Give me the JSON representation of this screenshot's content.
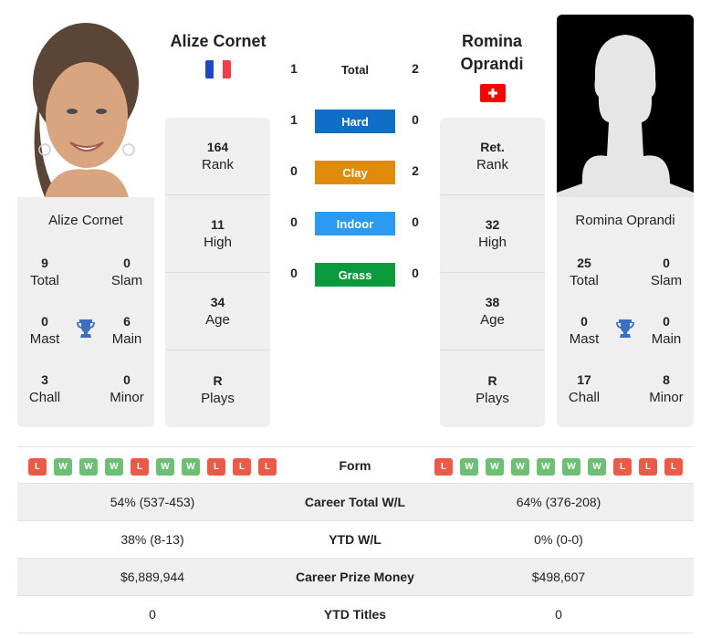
{
  "player_left": {
    "name": "Alize Cornet",
    "card_name": "Alize Cornet",
    "flag": "france-flag",
    "rank": {
      "value": "164",
      "label": "Rank"
    },
    "high": {
      "value": "11",
      "label": "High"
    },
    "age": {
      "value": "34",
      "label": "Age"
    },
    "plays": {
      "value": "R",
      "label": "Plays"
    },
    "titles": {
      "total": {
        "value": "9",
        "label": "Total"
      },
      "slam": {
        "value": "0",
        "label": "Slam"
      },
      "mast": {
        "value": "0",
        "label": "Mast"
      },
      "main": {
        "value": "6",
        "label": "Main"
      },
      "chall": {
        "value": "3",
        "label": "Chall"
      },
      "minor": {
        "value": "0",
        "label": "Minor"
      }
    },
    "form": [
      "L",
      "W",
      "W",
      "W",
      "L",
      "W",
      "W",
      "L",
      "L",
      "L"
    ]
  },
  "player_right": {
    "name_line1": "Romina",
    "name_line2": "Oprandi",
    "card_name": "Romina Oprandi",
    "flag": "switzerland-flag",
    "rank": {
      "value": "Ret.",
      "label": "Rank"
    },
    "high": {
      "value": "32",
      "label": "High"
    },
    "age": {
      "value": "38",
      "label": "Age"
    },
    "plays": {
      "value": "R",
      "label": "Plays"
    },
    "titles": {
      "total": {
        "value": "25",
        "label": "Total"
      },
      "slam": {
        "value": "0",
        "label": "Slam"
      },
      "mast": {
        "value": "0",
        "label": "Mast"
      },
      "main": {
        "value": "0",
        "label": "Main"
      },
      "chall": {
        "value": "17",
        "label": "Chall"
      },
      "minor": {
        "value": "8",
        "label": "Minor"
      }
    },
    "form": [
      "L",
      "W",
      "W",
      "W",
      "W",
      "W",
      "W",
      "L",
      "L",
      "L"
    ]
  },
  "h2h": {
    "total": {
      "label": "Total",
      "left": "1",
      "right": "2"
    },
    "surfaces": [
      {
        "label": "Hard",
        "left": "1",
        "right": "0",
        "color": "#0f6fc6"
      },
      {
        "label": "Clay",
        "left": "0",
        "right": "2",
        "color": "#e08b0b"
      },
      {
        "label": "Indoor",
        "left": "0",
        "right": "0",
        "color": "#2b9af3"
      },
      {
        "label": "Grass",
        "left": "0",
        "right": "0",
        "color": "#0a9a3c"
      }
    ]
  },
  "form_label": "Form",
  "stats": [
    {
      "label": "Career Total W/L",
      "left": "54% (537-453)",
      "right": "64% (376-208)"
    },
    {
      "label": "YTD W/L",
      "left": "38% (8-13)",
      "right": "0% (0-0)"
    },
    {
      "label": "Career Prize Money",
      "left": "$6,889,944",
      "right": "$498,607"
    },
    {
      "label": "YTD Titles",
      "left": "0",
      "right": "0"
    }
  ]
}
